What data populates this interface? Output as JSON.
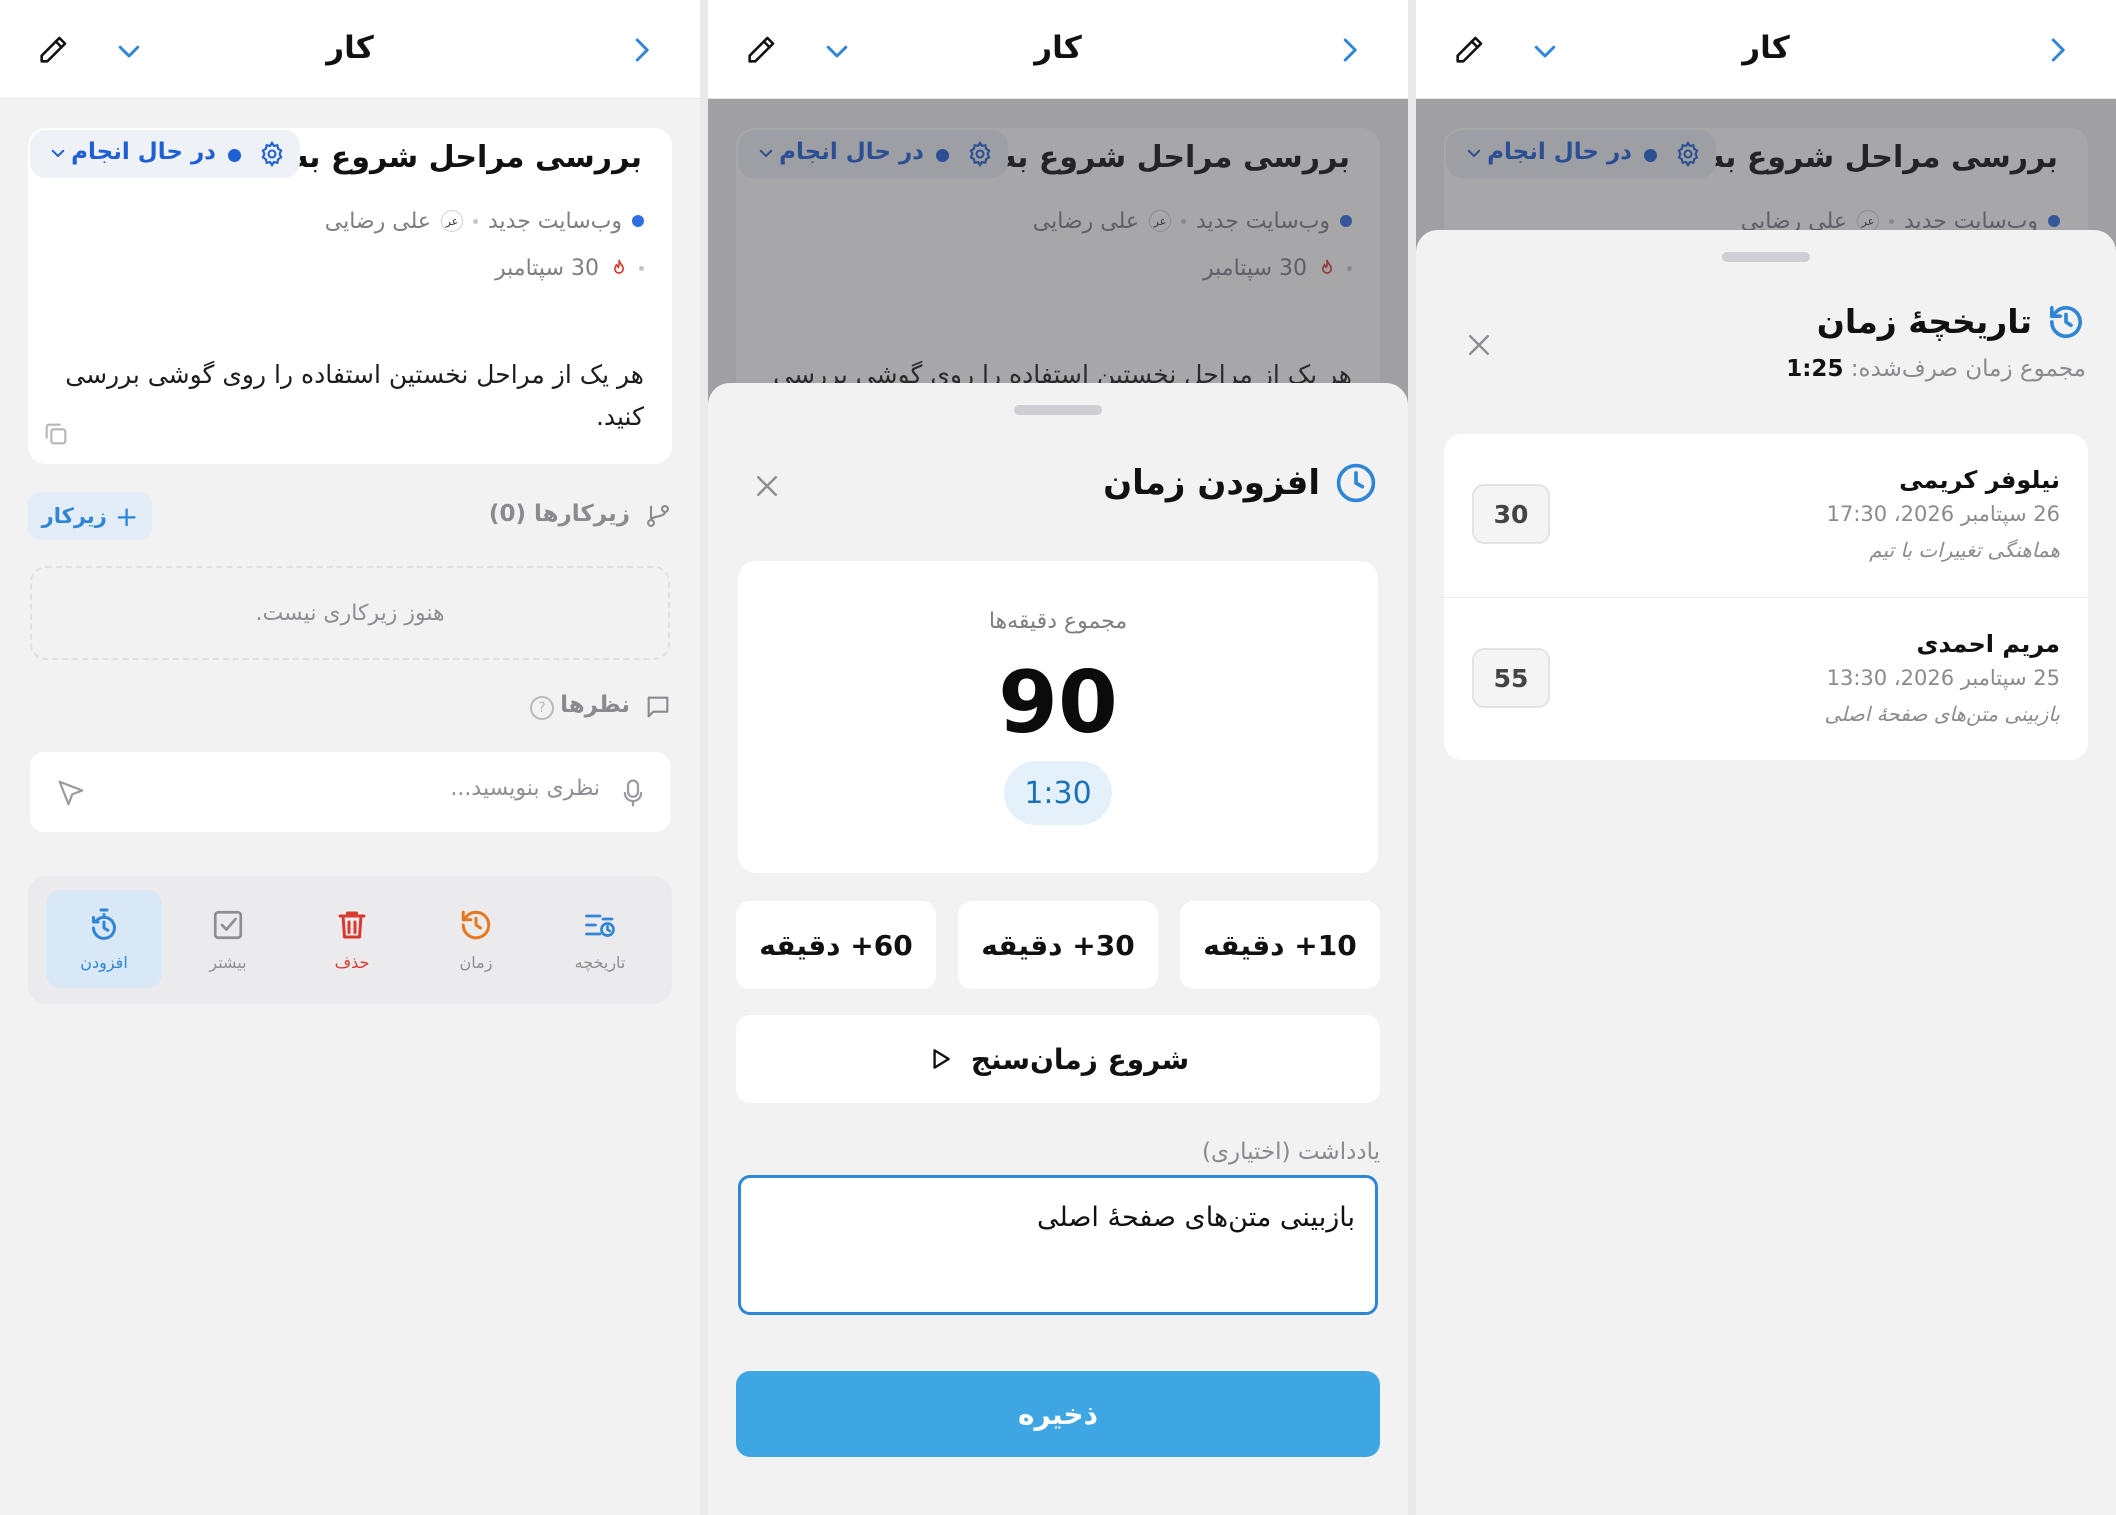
{
  "header": {
    "title": "کار"
  },
  "task": {
    "title": "بررسی مراحل شروع به کار",
    "status": "در حال انجام",
    "project": "وب‌سایت جدید",
    "assignee": "علی رضایی",
    "assignee_initials": "عر",
    "due": "30 سپتامبر",
    "description": "هر یک از مراحل نخستین استفاده را روی گوشی بررسی کنید."
  },
  "subtasks": {
    "label": "زیرکارها (0)",
    "add_label": "زیرکار",
    "empty": "هنوز زیرکاری نیست."
  },
  "comments": {
    "label": "نظرها",
    "help": "?",
    "placeholder": "نظری بنویسید..."
  },
  "actions": [
    {
      "label": "تاریخچه"
    },
    {
      "label": "زمان"
    },
    {
      "label": "حذف"
    },
    {
      "label": "بیشتر"
    },
    {
      "label": "افزودن"
    }
  ],
  "add_time": {
    "title": "افزودن زمان",
    "minutes_label": "مجموع دقیقه‌ها",
    "minutes_value": "90",
    "hours_value": "1:30",
    "quick": [
      "10+ دقیقه",
      "30+ دقیقه",
      "60+ دقیقه"
    ],
    "start_timer": "شروع زمان‌سنج",
    "note_label": "یادداشت (اختیاری)",
    "note_value": "بازبینی متن‌های صفحهٔ اصلی",
    "save": "ذخیره"
  },
  "history": {
    "title": "تاریخچهٔ زمان",
    "total_label": "مجموع زمان صرف‌شده:",
    "total_value": "1:25",
    "entries": [
      {
        "name": "نیلوفر کریمی",
        "when": "26 سپتامبر 2026، 17:30",
        "note": "هماهنگی تغییرات با تیم",
        "minutes": "30"
      },
      {
        "name": "مریم احمدی",
        "when": "25 سپتامبر 2026، 13:30",
        "note": "بازبینی متن‌های صفحهٔ اصلی",
        "minutes": "55"
      }
    ]
  },
  "colors": {
    "accent": "#2f86d6",
    "status_blue": "#1e5fd4",
    "save_button": "#3fa6e4",
    "danger": "#d93a2f",
    "time_orange": "#e8761e"
  }
}
